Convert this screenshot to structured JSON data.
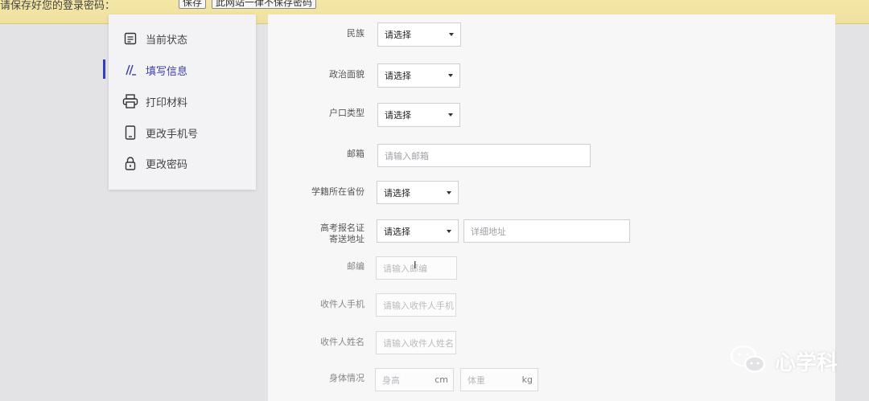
{
  "banner": {
    "text": "请保存好您的登录密码：",
    "save_label": "保存",
    "skip_label": "此网站一律不保存密码"
  },
  "sidebar": {
    "items": [
      {
        "label": "当前状态",
        "icon": "document-icon"
      },
      {
        "label": "填写信息",
        "icon": "edit-icon"
      },
      {
        "label": "打印材料",
        "icon": "printer-icon"
      },
      {
        "label": "更改手机号",
        "icon": "phone-icon"
      },
      {
        "label": "更改密码",
        "icon": "lock-icon"
      }
    ],
    "active_index": 1
  },
  "form": {
    "ethnicity": {
      "label": "民族",
      "value": "请选择"
    },
    "political": {
      "label": "政治面貌",
      "value": "请选择"
    },
    "hukou": {
      "label": "户口类型",
      "value": "请选择"
    },
    "email": {
      "label": "邮箱",
      "placeholder": "请输入邮箱"
    },
    "province": {
      "label": "学籍所在省份",
      "value": "请选择"
    },
    "mail_address": {
      "label_line1": "高考报名证",
      "label_line2": "寄送地址",
      "value": "请选择",
      "detail_placeholder": "详细地址"
    },
    "postcode": {
      "label": "邮编",
      "placeholder": "请输入邮编"
    },
    "receiver_phone": {
      "label": "收件人手机",
      "placeholder": "请输入收件人手机"
    },
    "receiver_name": {
      "label": "收件人姓名",
      "placeholder": "请输入收件人姓名"
    },
    "body": {
      "label": "身体情况",
      "height_placeholder": "身高",
      "height_unit": "cm",
      "weight_placeholder": "体重",
      "weight_unit": "kg"
    }
  },
  "watermark": {
    "text": "心学科"
  },
  "colors": {
    "accent": "#3b3fa6",
    "banner": "#f4e7a6"
  }
}
